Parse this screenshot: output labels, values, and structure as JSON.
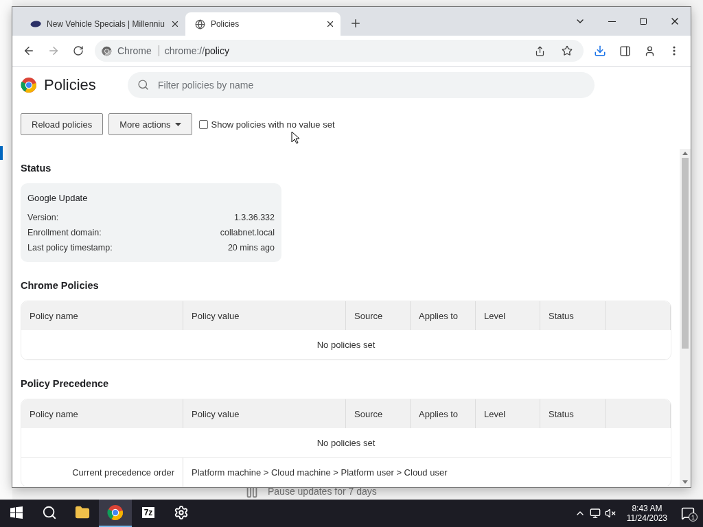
{
  "browser": {
    "tabs": [
      {
        "title": "New Vehicle Specials | Millenniu",
        "selected": false,
        "kind": "logo"
      },
      {
        "title": "Policies",
        "selected": true,
        "kind": "globe"
      }
    ],
    "address": {
      "chip": "Chrome",
      "scheme": "chrome://",
      "path": "policy"
    }
  },
  "page": {
    "title": "Policies",
    "search": {
      "placeholder": "Filter policies by name"
    },
    "buttons": [
      {
        "label": "Reload policies",
        "kind": "plain"
      },
      {
        "label": "More actions",
        "kind": "menu"
      }
    ],
    "show_unset": {
      "label": "Show policies with no value set",
      "checked": false
    },
    "status": {
      "heading": "Status",
      "card": {
        "title": "Google Update",
        "rows": [
          {
            "label": "Version:",
            "value": "1.3.36.332"
          },
          {
            "label": "Enrollment domain:",
            "value": "collabnet.local"
          },
          {
            "label": "Last policy timestamp:",
            "value": "20 mins ago"
          }
        ]
      }
    },
    "tables": [
      {
        "heading": "Chrome Policies",
        "columns": [
          "Policy name",
          "Policy value",
          "Source",
          "Applies to",
          "Level",
          "Status"
        ],
        "empty": "No policies set"
      },
      {
        "heading": "Policy Precedence",
        "columns": [
          "Policy name",
          "Policy value",
          "Source",
          "Applies to",
          "Level",
          "Status"
        ],
        "empty": "No policies set",
        "rows": [
          {
            "label": "Current precedence order",
            "value": "Platform machine > Cloud machine > Platform user > Cloud user"
          }
        ]
      }
    ]
  },
  "background": {
    "text": "Pause updates for 7 days"
  },
  "taskbar": {
    "apps": [
      {
        "kind": "search",
        "selected": false
      },
      {
        "kind": "folder",
        "selected": false
      },
      {
        "kind": "chrome",
        "selected": true
      },
      {
        "kind": "archiver",
        "label": "7z",
        "selected": false
      },
      {
        "kind": "settings",
        "selected": false
      }
    ],
    "time": "8:43 AM",
    "date": "11/24/2023",
    "notifications": "1"
  }
}
